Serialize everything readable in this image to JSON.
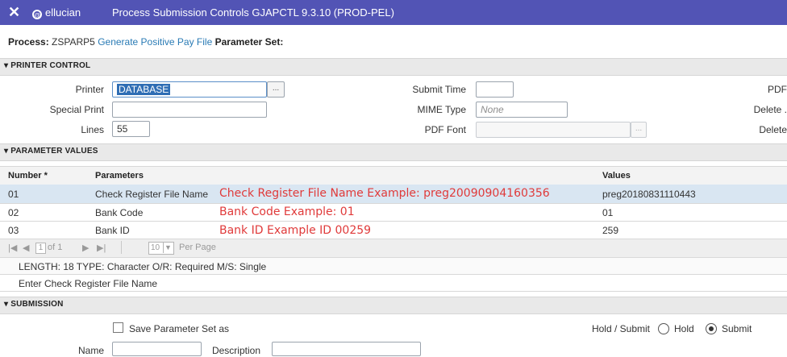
{
  "titlebar": {
    "close": "✕",
    "logo": "ellucian",
    "title": "Process Submission Controls GJAPCTL 9.3.10 (PROD-PEL)"
  },
  "process": {
    "process_label": "Process:",
    "process_code": "ZSPARP5",
    "process_name": "Generate Positive Pay File",
    "parameter_set_label": "Parameter Set:"
  },
  "printer_control": {
    "heading": "PRINTER CONTROL",
    "printer_label": "Printer",
    "printer_value": "DATABASE",
    "lookup_label": "...",
    "special_print_label": "Special Print",
    "special_print_value": "",
    "lines_label": "Lines",
    "lines_value": "55",
    "submit_time_label": "Submit Time",
    "submit_time_value": "",
    "mime_type_label": "MIME Type",
    "mime_type_placeholder": "None",
    "pdf_font_label": "PDF Font",
    "pdf_font_value": "",
    "pdf_label_cut": "PDF",
    "delete1_label_cut": "Delete .",
    "delete2_label_cut": "Delete"
  },
  "parameter_values": {
    "heading": "PARAMETER VALUES",
    "columns": {
      "number": "Number *",
      "parameters": "Parameters",
      "values": "Values"
    },
    "rows": [
      {
        "number": "01",
        "parameter": "Check Register File Name",
        "annotation": "Check Register File Name  Example: preg20090904160356",
        "value": "preg20180831110443"
      },
      {
        "number": "02",
        "parameter": "Bank Code",
        "annotation": "Bank Code  Example: 01",
        "value": "01"
      },
      {
        "number": "03",
        "parameter": "Bank ID",
        "annotation": "Bank ID  Example ID 00259",
        "value": "259"
      }
    ],
    "pager": {
      "page": "1",
      "of": "of 1",
      "per_page_value": "10",
      "per_page_label": "Per Page"
    },
    "info_line": "LENGTH: 18 TYPE: Character O/R: Required M/S: Single",
    "help_line": "Enter Check Register File Name"
  },
  "submission": {
    "heading": "SUBMISSION",
    "save_label": "Save Parameter Set as",
    "hold_submit_label": "Hold / Submit",
    "hold_label": "Hold",
    "submit_label": "Submit",
    "name_label": "Name",
    "name_value": "",
    "description_label": "Description",
    "description_value": ""
  }
}
